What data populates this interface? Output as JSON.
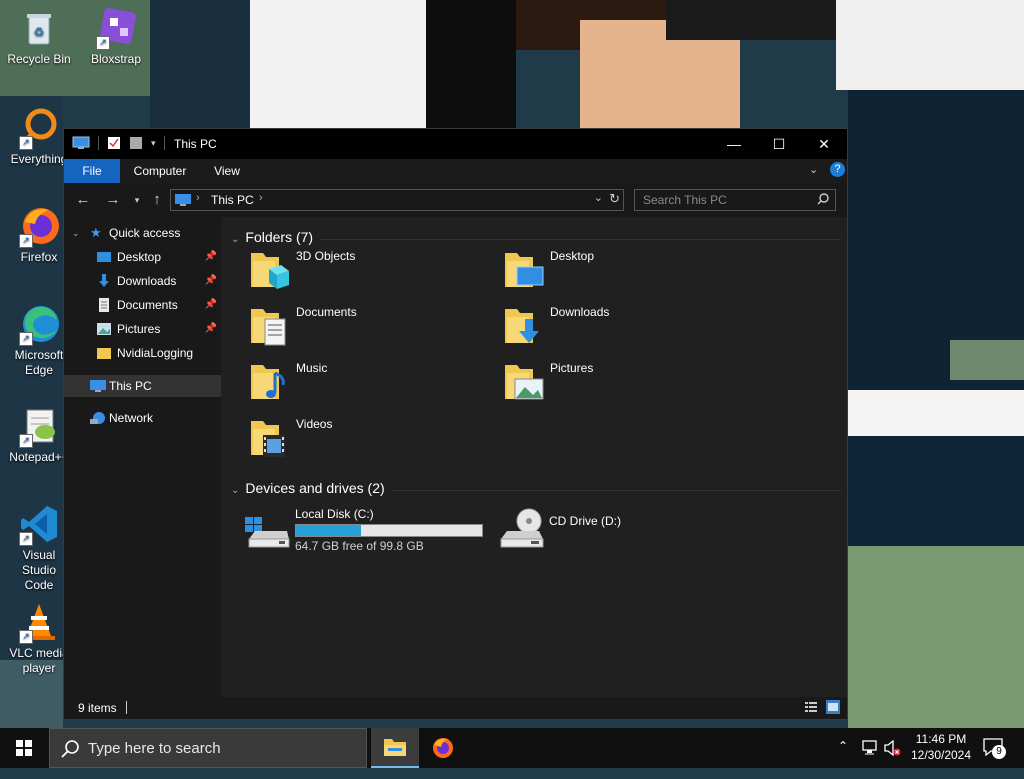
{
  "desktop": {
    "icons": [
      {
        "label": "Recycle Bin"
      },
      {
        "label": "Bloxstrap"
      },
      {
        "label": "Everything"
      },
      {
        "label": "Firefox"
      },
      {
        "label": "Microsoft Edge"
      },
      {
        "label": "Notepad++"
      },
      {
        "label": "Visual Studio Code"
      },
      {
        "label": "VLC media player"
      }
    ]
  },
  "window": {
    "title": "This PC",
    "ribbon_tabs": [
      "File",
      "Computer",
      "View"
    ],
    "address": {
      "crumb": "This PC"
    },
    "search": {
      "placeholder": "Search This PC"
    },
    "controls": {
      "minimize": "—",
      "maximize": "☐",
      "close": "✕",
      "help": "?"
    },
    "nav": {
      "quick_access": "Quick access",
      "items": [
        "Desktop",
        "Downloads",
        "Documents",
        "Pictures",
        "NvidiaLogging"
      ],
      "this_pc": "This PC",
      "network": "Network"
    },
    "folders_header": "Folders (7)",
    "folders": [
      "3D Objects",
      "Desktop",
      "Documents",
      "Downloads",
      "Music",
      "Pictures",
      "Videos"
    ],
    "drives_header": "Devices and drives (2)",
    "drives": [
      {
        "name": "Local Disk (C:)",
        "free_text": "64.7 GB free of 99.8 GB",
        "used_fraction": 0.35
      },
      {
        "name": "CD Drive (D:)"
      }
    ],
    "status": {
      "item_count": "9 items"
    }
  },
  "taskbar": {
    "search_placeholder": "Type here to search",
    "time": "11:46 PM",
    "date": "12/30/2024",
    "notification_count": "9"
  },
  "colors": {
    "accent": "#1565c0",
    "progress": "#26a0da"
  }
}
